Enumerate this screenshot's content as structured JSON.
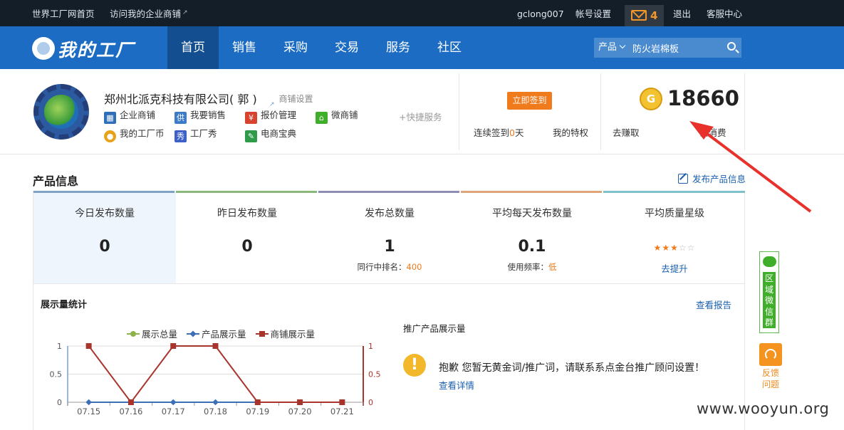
{
  "topbar": {
    "home_link": "世界工厂网首页",
    "visit_shop": "访问我的企业商铺",
    "username": "gclong007",
    "account_settings": "帐号设置",
    "message_count": "4",
    "logout": "退出",
    "support": "客服中心"
  },
  "nav": {
    "logo_text": "我的工厂",
    "tabs": [
      "首页",
      "销售",
      "采购",
      "交易",
      "服务",
      "社区"
    ],
    "search_category": "产品",
    "search_value": "防火岩棉板"
  },
  "company": {
    "name": "郑州北派克科技有限公司",
    "paren_open": "(",
    "surname": "郭",
    "paren_close": ")",
    "shop_settings": "商铺设置",
    "quick_links": [
      {
        "label": "企业商铺",
        "icon": "shop-icon",
        "color": "#2f6fb8"
      },
      {
        "label": "我要销售",
        "icon": "sell-icon",
        "color": "#3d7bc8"
      },
      {
        "label": "报价管理",
        "icon": "quote-icon",
        "color": "#d8432f"
      },
      {
        "label": "微商铺",
        "icon": "wechat-shop-icon",
        "color": "#3fae2a"
      },
      {
        "label": "我的工厂币",
        "icon": "coin-icon",
        "color": "#e8a21a"
      },
      {
        "label": "工厂秀",
        "icon": "show-icon",
        "color": "#3d5fc8"
      },
      {
        "label": "电商宝典",
        "icon": "book-icon",
        "color": "#2e9a4a"
      }
    ],
    "quick_service": "+快捷服务"
  },
  "signin": {
    "button": "立即签到",
    "streak_prefix": "连续签到",
    "streak_days": "0",
    "streak_suffix": "天",
    "privileges": "我的特权"
  },
  "coins": {
    "symbol": "G",
    "amount": "18660",
    "earn": "去赚取",
    "spend": "去消费"
  },
  "product_info": {
    "title": "产品信息",
    "publish_link": "发布产品信息",
    "stats": [
      {
        "label": "今日发布数量",
        "value": "0",
        "color": "#7fa3c8"
      },
      {
        "label": "昨日发布数量",
        "value": "0",
        "color": "#8ab87a"
      },
      {
        "label": "发布总数量",
        "value": "1",
        "sub_label": "同行中排名：",
        "sub_value": "400",
        "color": "#8e8cb6"
      },
      {
        "label": "平均每天发布数量",
        "value": "0.1",
        "sub_label": "使用频率：",
        "sub_value": "低",
        "color": "#e0a47a"
      },
      {
        "label": "平均质量星级",
        "rating": 3,
        "max_rating": 5,
        "link": "去提升",
        "color": "#7fc1c8"
      }
    ]
  },
  "display_stats": {
    "title": "展示量统计",
    "report_link": "查看报告",
    "promo_title": "推广产品展示量",
    "promo_message": "抱歉 您暂无黄金词/推广词，请联系系点金台推广顾问设置！",
    "promo_details": "查看详情"
  },
  "chart_data": {
    "type": "line",
    "x": [
      "07.15",
      "07.16",
      "07.17",
      "07.18",
      "07.19",
      "07.20",
      "07.21"
    ],
    "y_ticks_left": [
      "1",
      "0.5",
      "0"
    ],
    "y_ticks_right": [
      "1",
      "0.5",
      "0"
    ],
    "ylim": [
      0,
      1
    ],
    "legend_position": "top",
    "series": [
      {
        "name": "展示总量",
        "values": [
          0,
          0,
          0,
          0,
          0,
          0,
          0
        ],
        "color": "#8cb44a",
        "axis": "left"
      },
      {
        "name": "产品展示量",
        "values": [
          0,
          0,
          0,
          0,
          0,
          0,
          0
        ],
        "color": "#3d6fb8",
        "axis": "left"
      },
      {
        "name": "商铺展示量",
        "values": [
          1,
          0,
          1,
          1,
          0,
          0,
          0
        ],
        "color": "#a9342c",
        "axis": "right"
      }
    ]
  },
  "sidebar": {
    "wechat_group": "区域微信群",
    "feedback": "反馈问题"
  },
  "watermark": "www.wooyun.org",
  "colors": {
    "topbar": "#141e28",
    "nav": "#1b6cc2",
    "accent": "#f07b1c",
    "link": "#1b5fae",
    "annotation_arrow": "#e8312a"
  }
}
